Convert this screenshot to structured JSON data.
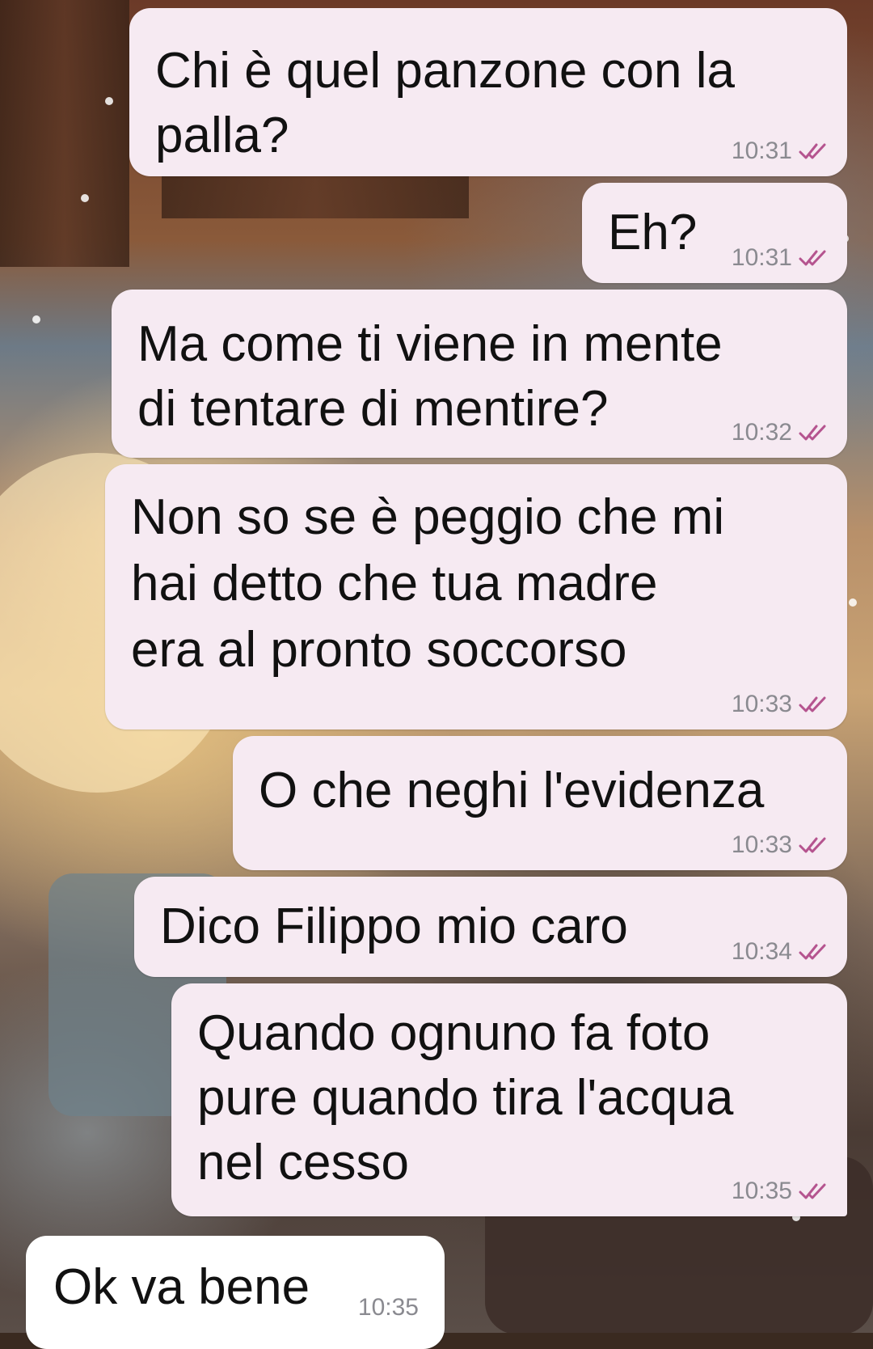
{
  "chat": {
    "messages": [
      {
        "direction": "out",
        "lines": [
          "Chi è quel panzone con la",
          "palla?"
        ],
        "time": "10:31",
        "status": "read-double-check"
      },
      {
        "direction": "out",
        "lines": [
          "Eh?"
        ],
        "time": "10:31",
        "status": "read-double-check"
      },
      {
        "direction": "out",
        "lines": [
          "Ma come ti viene in mente",
          "di tentare di mentire?"
        ],
        "time": "10:32",
        "status": "read-double-check"
      },
      {
        "direction": "out",
        "lines": [
          "Non so se è peggio che mi",
          "hai detto che tua madre",
          "era al pronto soccorso"
        ],
        "time": "10:33",
        "status": "read-double-check"
      },
      {
        "direction": "out",
        "lines": [
          "O che neghi l'evidenza"
        ],
        "time": "10:33",
        "status": "read-double-check"
      },
      {
        "direction": "out",
        "lines": [
          "Dico Filippo mio caro"
        ],
        "time": "10:34",
        "status": "read-double-check"
      },
      {
        "direction": "out",
        "lines": [
          "Quando ognuno fa foto",
          "pure quando tira l'acqua",
          "nel cesso"
        ],
        "time": "10:35",
        "status": "read-double-check"
      },
      {
        "direction": "in",
        "lines": [
          "Ok va bene"
        ],
        "time": "10:35",
        "status": ""
      }
    ]
  },
  "colors": {
    "outgoing_bubble": "#f6eaf2",
    "incoming_bubble": "#ffffff",
    "read_ticks": "#b5548f",
    "timestamp": "#8a8a90"
  }
}
